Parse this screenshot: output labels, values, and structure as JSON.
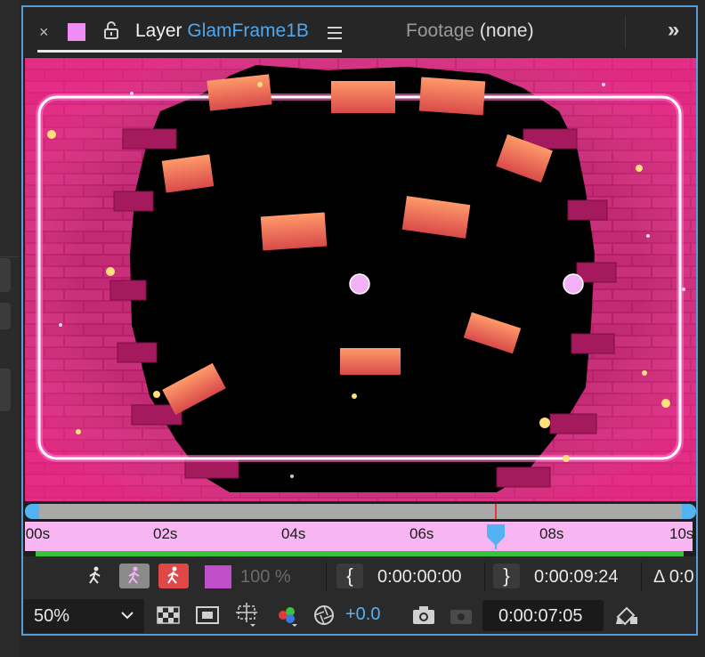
{
  "tab": {
    "close": "×",
    "prefix": "Layer",
    "name": "GlamFrame1B",
    "footage_label": "Footage",
    "footage_value": "(none)",
    "more": "»",
    "swatch_color": "#f08cf5"
  },
  "timeline": {
    "ticks": [
      ":00s",
      "02s",
      "04s",
      "06s",
      "08s",
      "10s"
    ],
    "current_time_fraction": 0.705,
    "ruler_color": "#f7b6f2",
    "cti_color": "#53b3f2"
  },
  "controls": {
    "opacity": "100 %",
    "in_point": "0:00:00:00",
    "out_point": "0:00:09:24",
    "duration_prefix": "Δ 0:0",
    "label_color": "#c14fcb"
  },
  "viewer_controls": {
    "zoom": "50%",
    "exposure": "+0.0",
    "current_time": "0:00:07:05"
  },
  "icons": [
    "close-icon",
    "color-label-icon",
    "lock-icon",
    "panel-menu-icon",
    "expand-icon",
    "walk-icon",
    "transparency-grid-icon",
    "mask-icon",
    "region-icon",
    "color-channels-icon",
    "aperture-icon",
    "camera-icon",
    "snapshot-icon",
    "edit-icon"
  ]
}
